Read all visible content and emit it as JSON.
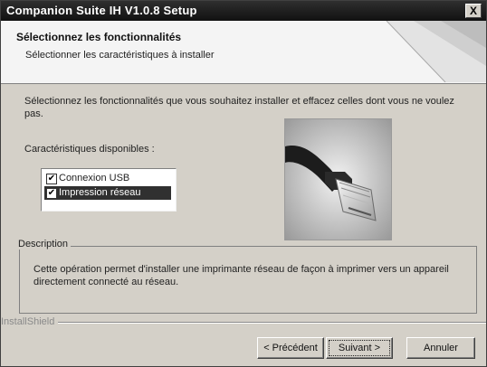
{
  "window": {
    "title": "Companion Suite IH V1.0.8 Setup",
    "close_label": "X"
  },
  "header": {
    "title": "Sélectionnez les fonctionnalités",
    "subtitle": "Sélectionner les caractéristiques à installer"
  },
  "body": {
    "instructions": "Sélectionnez les fonctionnalités que vous souhaitez installer et effacez celles dont vous ne voulez pas.",
    "features_label": "Caractéristiques disponibles :"
  },
  "features": [
    {
      "label": "Connexion USB",
      "checked": true,
      "selected": false
    },
    {
      "label": "Impression réseau",
      "checked": true,
      "selected": true
    }
  ],
  "description": {
    "legend": "Description",
    "text": "Cette opération permet d'installer une imprimante réseau de façon à imprimer vers un appareil directement connecté au réseau."
  },
  "footer": {
    "brand": "InstallShield"
  },
  "buttons": {
    "back": "< Précédent",
    "next": "Suivant >",
    "cancel": "Annuler"
  },
  "icons": {
    "close": "close-icon",
    "check": "check-icon",
    "product": "network-cable-image"
  }
}
